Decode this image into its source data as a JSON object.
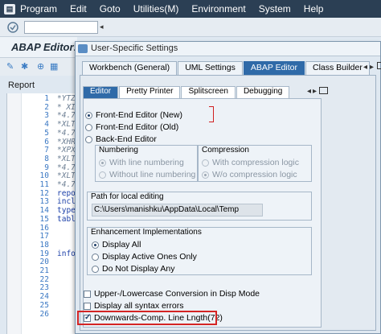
{
  "menubar": {
    "items": [
      "Program",
      "Edit",
      "Goto",
      "Utilities(M)",
      "Environment",
      "System",
      "Help"
    ]
  },
  "editor": {
    "title": "ABAP Editor:",
    "report_label": "Report",
    "line_numbers": [
      "1",
      "2",
      "3",
      "4",
      "5",
      "6",
      "7",
      "8",
      "9",
      "10",
      "11",
      "12",
      "13",
      "14",
      "15",
      "16",
      "17",
      "18",
      "19",
      "20",
      "21",
      "22",
      "23",
      "24",
      "25",
      "26"
    ],
    "lines": [
      {
        "text": "*YTZ",
        "kind": "com"
      },
      {
        "text": "* XI",
        "kind": "com"
      },
      {
        "text": "*4.7",
        "kind": "com"
      },
      {
        "text": "*XLT",
        "kind": "com"
      },
      {
        "text": "*4.7",
        "kind": "com"
      },
      {
        "text": "*XHR",
        "kind": "com"
      },
      {
        "text": "*XPX",
        "kind": "com"
      },
      {
        "text": "*XLT",
        "kind": "com"
      },
      {
        "text": "*4.7",
        "kind": "com"
      },
      {
        "text": "*XLT",
        "kind": "com"
      },
      {
        "text": "*4.7",
        "kind": "com"
      },
      {
        "text": "repo",
        "kind": "kw"
      },
      {
        "text": "incl",
        "kind": "kw"
      },
      {
        "text": "type",
        "kind": "kw"
      },
      {
        "text": "tabl",
        "kind": "kw"
      },
      {
        "text": "",
        "kind": "kw"
      },
      {
        "text": "",
        "kind": "kw"
      },
      {
        "text": "",
        "kind": "kw"
      },
      {
        "text": "info",
        "kind": "kw"
      },
      {
        "text": "",
        "kind": "kw"
      }
    ]
  },
  "dialog": {
    "title": "User-Specific Settings",
    "tabs": [
      "Workbench (General)",
      "UML Settings",
      "ABAP Editor",
      "Class Builder"
    ],
    "active_tab": 2,
    "subtabs": [
      "Editor",
      "Pretty Printer",
      "Splitscreen",
      "Debugging"
    ],
    "active_subtab": 0,
    "editor_modes": [
      {
        "label": "Front-End Editor (New)",
        "selected": true
      },
      {
        "label": "Front-End Editor (Old)",
        "selected": false
      },
      {
        "label": "Back-End Editor",
        "selected": false
      }
    ],
    "numbering": {
      "title": "Numbering",
      "options": [
        {
          "label": "With line numbering",
          "selected": true
        },
        {
          "label": "Without line numbering",
          "selected": false
        }
      ]
    },
    "compression": {
      "title": "Compression",
      "options": [
        {
          "label": "With compression logic",
          "selected": false
        },
        {
          "label": "W/o compression logic",
          "selected": true
        }
      ]
    },
    "path": {
      "title": "Path for local editing",
      "value": "C:\\Users\\manishku\\AppData\\Local\\Temp"
    },
    "enhancement": {
      "title": "Enhancement Implementations",
      "options": [
        {
          "label": "Display All",
          "selected": true
        },
        {
          "label": "Display Active Ones Only",
          "selected": false
        },
        {
          "label": "Do Not Display Any",
          "selected": false
        }
      ]
    },
    "checkboxes": [
      {
        "label": "Upper-/Lowercase Conversion in Disp Mode",
        "checked": false
      },
      {
        "label": "Display all syntax errors",
        "checked": false
      },
      {
        "label": "Downwards-Comp. Line Lngth(72)",
        "checked": true
      }
    ]
  },
  "colors": {
    "menubar": "#2b3f54",
    "active_tab": "#2f6aa8",
    "highlight": "#d42424"
  }
}
